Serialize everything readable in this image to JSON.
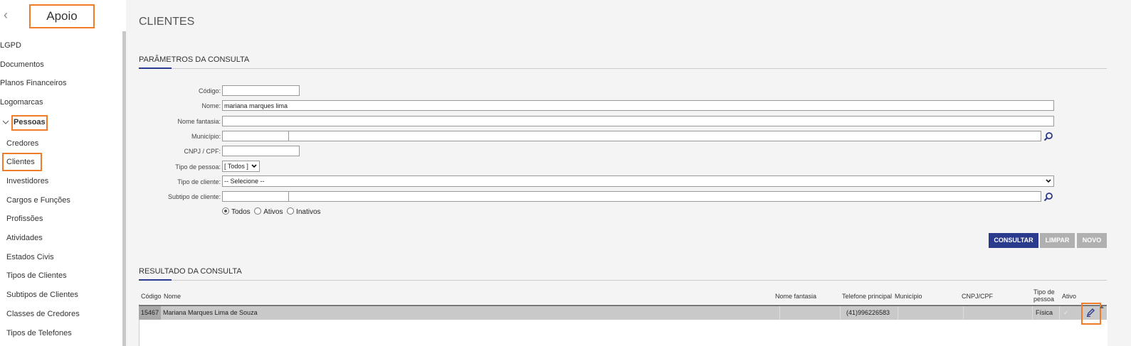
{
  "sidebar": {
    "title": "Apoio",
    "back_icon": "chevron-left-icon",
    "items": [
      {
        "label": "LGPD"
      },
      {
        "label": "Documentos"
      },
      {
        "label": "Planos Financeiros"
      },
      {
        "label": "Logomarcas"
      }
    ],
    "group": {
      "label": "Pessoas",
      "icon": "chevron-down-icon"
    },
    "subitems": [
      {
        "label": "Credores"
      },
      {
        "label": "Clientes"
      },
      {
        "label": "Investidores"
      },
      {
        "label": "Cargos e Funções"
      },
      {
        "label": "Profissões"
      },
      {
        "label": "Atividades"
      },
      {
        "label": "Estados Civis"
      },
      {
        "label": "Tipos de Clientes"
      },
      {
        "label": "Subtipos de Clientes"
      },
      {
        "label": "Classes de Credores"
      },
      {
        "label": "Tipos de Telefones"
      }
    ]
  },
  "page": {
    "title": "CLIENTES"
  },
  "params": {
    "section_title": "PARÂMETROS DA CONSULTA",
    "codigo": {
      "label": "Código:",
      "value": ""
    },
    "nome": {
      "label": "Nome:",
      "value": "mariana marques lima"
    },
    "nome_fantasia": {
      "label": "Nome fantasia:",
      "value": ""
    },
    "municipio": {
      "label": "Município:",
      "code": "",
      "value": ""
    },
    "cnpj": {
      "label": "CNPJ / CPF:",
      "value": ""
    },
    "tipo_pessoa": {
      "label": "Tipo de pessoa:",
      "value": "[ Todos ]"
    },
    "tipo_cliente": {
      "label": "Tipo de cliente:",
      "value": "-- Selecione --"
    },
    "subtipo_cliente": {
      "label": "Subtipo de cliente:",
      "code": "",
      "value": ""
    },
    "status": {
      "options": [
        "Todos",
        "Ativos",
        "Inativos"
      ],
      "selected": "Todos"
    }
  },
  "buttons": {
    "consultar": "CONSULTAR",
    "limpar": "LIMPAR",
    "novo": "NOVO"
  },
  "colors": {
    "primary": "#2a3a8c",
    "disabled": "#b0b0b0",
    "highlight": "#f07c2a"
  },
  "results": {
    "section_title": "RESULTADO DA CONSULTA",
    "columns": {
      "codigo": "Código",
      "nome": "Nome",
      "nome_fantasia": "Nome fantasia",
      "telefone": "Telefone principal",
      "municipio": "Município",
      "cnpj": "CNPJ/CPF",
      "tipo_pessoa": "Tipo de pessoa",
      "ativo": "Ativo"
    },
    "rows": [
      {
        "codigo": "15467",
        "nome": "Mariana Marques Lima de Souza",
        "nome_fantasia": "",
        "telefone": "(41)996226583",
        "municipio": "",
        "cnpj": "",
        "tipo_pessoa": "Física",
        "ativo": "✓",
        "edit_icon": "pencil-icon"
      }
    ]
  }
}
